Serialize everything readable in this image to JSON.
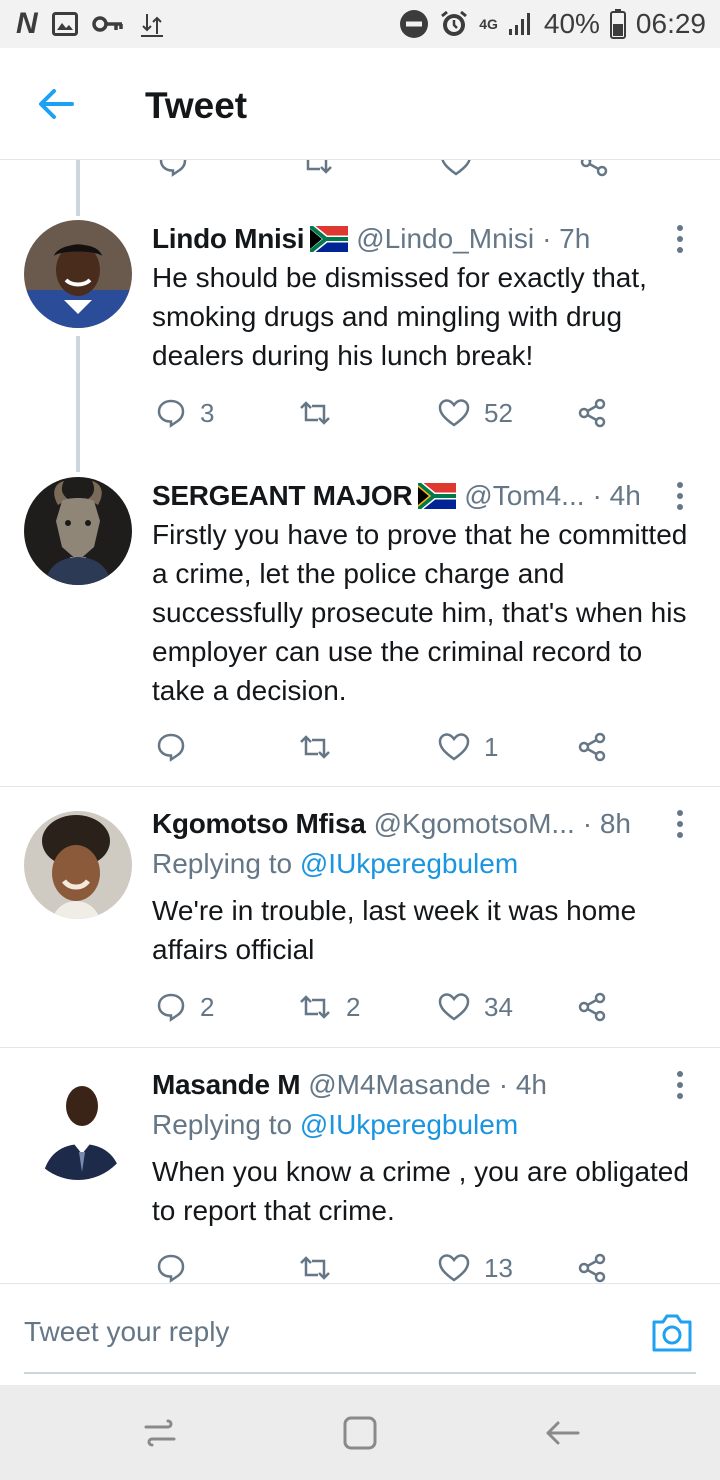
{
  "status_bar": {
    "n_label": "N",
    "network": "4G",
    "battery": "40%",
    "time": "06:29"
  },
  "header": {
    "title": "Tweet"
  },
  "tweets": [
    {
      "name": "Lindo Mnisi",
      "handle": "@Lindo_Mnisi",
      "time": "· 7h",
      "text": "He should be dismissed for exactly that, smoking drugs and mingling with drug dealers during his lunch break!",
      "replies": "3",
      "retweets": "",
      "likes": "52"
    },
    {
      "name": "SERGEANT MAJOR",
      "handle": "@Tom4...",
      "time": "· 4h",
      "text": "Firstly you have to prove that he committed a crime, let the police charge and successfully prosecute him, that's when his employer can use the criminal record to take a decision.",
      "replies": "",
      "retweets": "",
      "likes": "1"
    },
    {
      "name": "Kgomotso Mfisa",
      "handle": "@KgomotsoM...",
      "time": "· 8h",
      "replying_label": "Replying to",
      "replying_to": "@IUkperegbulem",
      "text": "We're in trouble, last week it was home affairs official",
      "replies": "2",
      "retweets": "2",
      "likes": "34"
    },
    {
      "name": "Masande M",
      "handle": "@M4Masande",
      "time": "· 4h",
      "replying_label": "Replying to",
      "replying_to": "@IUkperegbulem",
      "text": "When you know a crime , you are obligated to report that crime.",
      "replies": "",
      "retweets": "",
      "likes": "13"
    }
  ],
  "composer": {
    "placeholder": "Tweet your reply"
  },
  "colors": {
    "accent": "#1da1f2",
    "mention": "#1b95e0",
    "muted_text": "#657786",
    "primary_text": "#14171a",
    "divider": "#e1e8ed"
  }
}
